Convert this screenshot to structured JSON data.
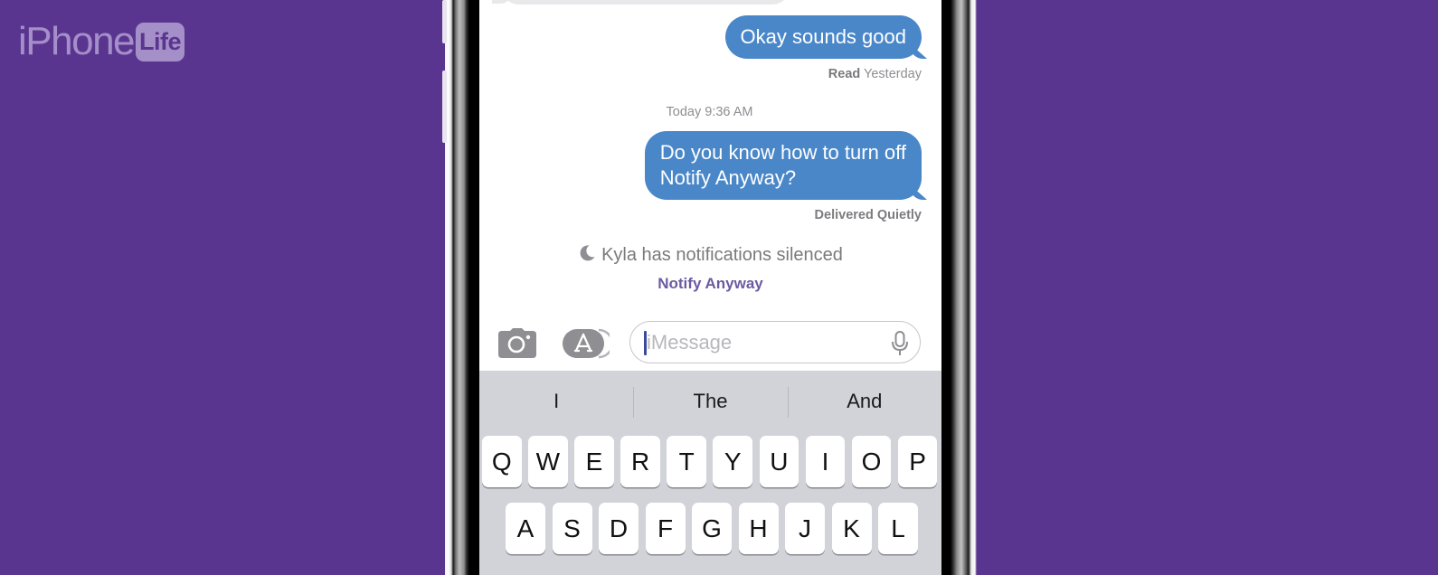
{
  "branding": {
    "logo_main": "iPhone",
    "logo_badge": "Life"
  },
  "conversation": {
    "messages": [
      {
        "direction": "outgoing",
        "text": "Okay sounds good",
        "status_label": "Read",
        "status_time": "Yesterday"
      },
      {
        "direction": "outgoing",
        "text_line1": "Do you know how to turn off",
        "text_line2": "Notify Anyway?",
        "status": "Delivered Quietly"
      }
    ],
    "timestamp": "Today 9:36 AM",
    "focus_notice": {
      "icon": "moon-icon",
      "text": "Kyla has notifications silenced",
      "action": "Notify Anyway"
    }
  },
  "input_bar": {
    "camera_icon": "camera-icon",
    "apps_icon": "app-store-icon",
    "placeholder": "iMessage",
    "value": "",
    "mic_icon": "microphone-icon"
  },
  "keyboard": {
    "suggestions": [
      "I",
      "The",
      "And"
    ],
    "row1": [
      "Q",
      "W",
      "E",
      "R",
      "T",
      "Y",
      "U",
      "I",
      "O",
      "P"
    ],
    "row2": [
      "A",
      "S",
      "D",
      "F",
      "G",
      "H",
      "J",
      "K",
      "L"
    ]
  },
  "colors": {
    "background": "#5a3590",
    "outgoing_bubble": "#4a87c9",
    "incoming_bubble": "#e9e9eb",
    "notify_link": "#6a5ba0",
    "keyboard_bg": "#d2d3d8"
  }
}
